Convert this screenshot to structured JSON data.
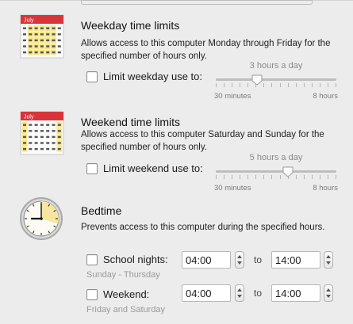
{
  "weekday": {
    "icon_month": "July",
    "title": "Weekday time limits",
    "description": "Allows access to this computer Monday through Friday for the specified number of hours only.",
    "checkbox_label": "Limit weekday use to:",
    "checked": false,
    "slider_value_label": "3 hours a day",
    "slider_min": "30 minutes",
    "slider_max": "8 hours",
    "slider_fraction": 0.34
  },
  "weekend": {
    "icon_month": "July",
    "title": "Weekend time limits",
    "description": "Allows access to this computer Saturday and Sunday for the specified number of hours only.",
    "checkbox_label": "Limit weekend use to:",
    "checked": false,
    "slider_value_label": "5 hours a day",
    "slider_min": "30 minutes",
    "slider_max": "8 hours",
    "slider_fraction": 0.6
  },
  "bedtime": {
    "title": "Bedtime",
    "description": "Prevents access to this computer during the specified hours.",
    "to_label": "to",
    "school_nights": {
      "label": "School nights:",
      "checked": false,
      "subtitle": "Sunday - Thursday",
      "start": "04:00",
      "end": "14:00"
    },
    "weekend": {
      "label": "Weekend:",
      "checked": false,
      "subtitle": "Friday and Saturday",
      "start": "04:00",
      "end": "14:00"
    }
  },
  "colors": {
    "calendar_header": "#d9343a",
    "calendar_weekend_highlight": "#f7e88c",
    "clock_face": "#f6e6a0"
  },
  "icons": [
    "calendar-icon",
    "clock-icon"
  ]
}
